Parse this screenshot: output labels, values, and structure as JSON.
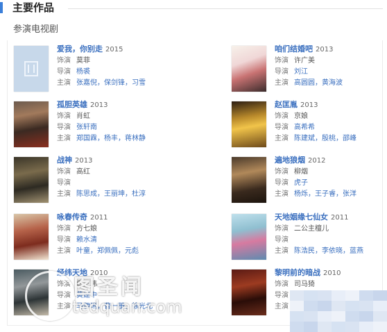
{
  "section": {
    "title": "主要作品"
  },
  "subsection": {
    "title": "参演电视剧"
  },
  "labels": {
    "role": "饰演",
    "director": "导演",
    "cast": "主演"
  },
  "works": [
    {
      "title": "爱我，你别走",
      "year": "2015",
      "role": "莫菲",
      "director": [
        "杨裘"
      ],
      "cast": [
        "张嘉倪",
        "保剑锋",
        "习雪"
      ],
      "poster": "placeholder"
    },
    {
      "title": "咱们结婚吧",
      "year": "2013",
      "role": "许广美",
      "director": [
        "刘江"
      ],
      "cast": [
        "高圆圆",
        "黄海波"
      ],
      "poster": "image"
    },
    {
      "title": "孤胆英雄",
      "year": "2013",
      "role": "肖虹",
      "director": [
        "张轩南"
      ],
      "cast": [
        "郑国霖",
        "杨丰",
        "蒋林静"
      ],
      "poster": "image"
    },
    {
      "title": "赵匡胤",
      "year": "2013",
      "role": "京娘",
      "director": [
        "高希希"
      ],
      "cast": [
        "陈建斌",
        "殷桃",
        "邵峰"
      ],
      "poster": "image"
    },
    {
      "title": "战神",
      "year": "2013",
      "role": "高红",
      "director": [],
      "cast": [
        "陈思成",
        "王丽坤",
        "杜淳"
      ],
      "poster": "image"
    },
    {
      "title": "遍地狼烟",
      "year": "2012",
      "role": "柳烟",
      "director": [
        "虎子"
      ],
      "cast": [
        "杨烁",
        "王子睿",
        "张洋"
      ],
      "poster": "image"
    },
    {
      "title": "咏春传奇",
      "year": "2011",
      "role": "方七娘",
      "director": [
        "赖水清"
      ],
      "cast": [
        "叶童",
        "郑佩佩",
        "元彪"
      ],
      "poster": "image"
    },
    {
      "title": "天地姻缘七仙女",
      "year": "2011",
      "role": "二公主檀儿",
      "director": [],
      "cast": [
        "陈浩民",
        "李依晓",
        "蓝燕"
      ],
      "poster": "image"
    },
    {
      "title": "经纬天地",
      "year": "2010",
      "role": "倡王玮",
      "director": [
        "黄建中"
      ],
      "cast": [
        "马伊琍",
        "曹一册",
        "徐光北"
      ],
      "poster": "image"
    },
    {
      "title": "黎明前的暗战",
      "year": "2010",
      "role": "司马猗",
      "director": [
        "高群"
      ],
      "cast": [
        "冰"
      ],
      "poster": "image"
    }
  ],
  "watermark": {
    "cn": "图圣闻",
    "en": "tedquan.com"
  }
}
